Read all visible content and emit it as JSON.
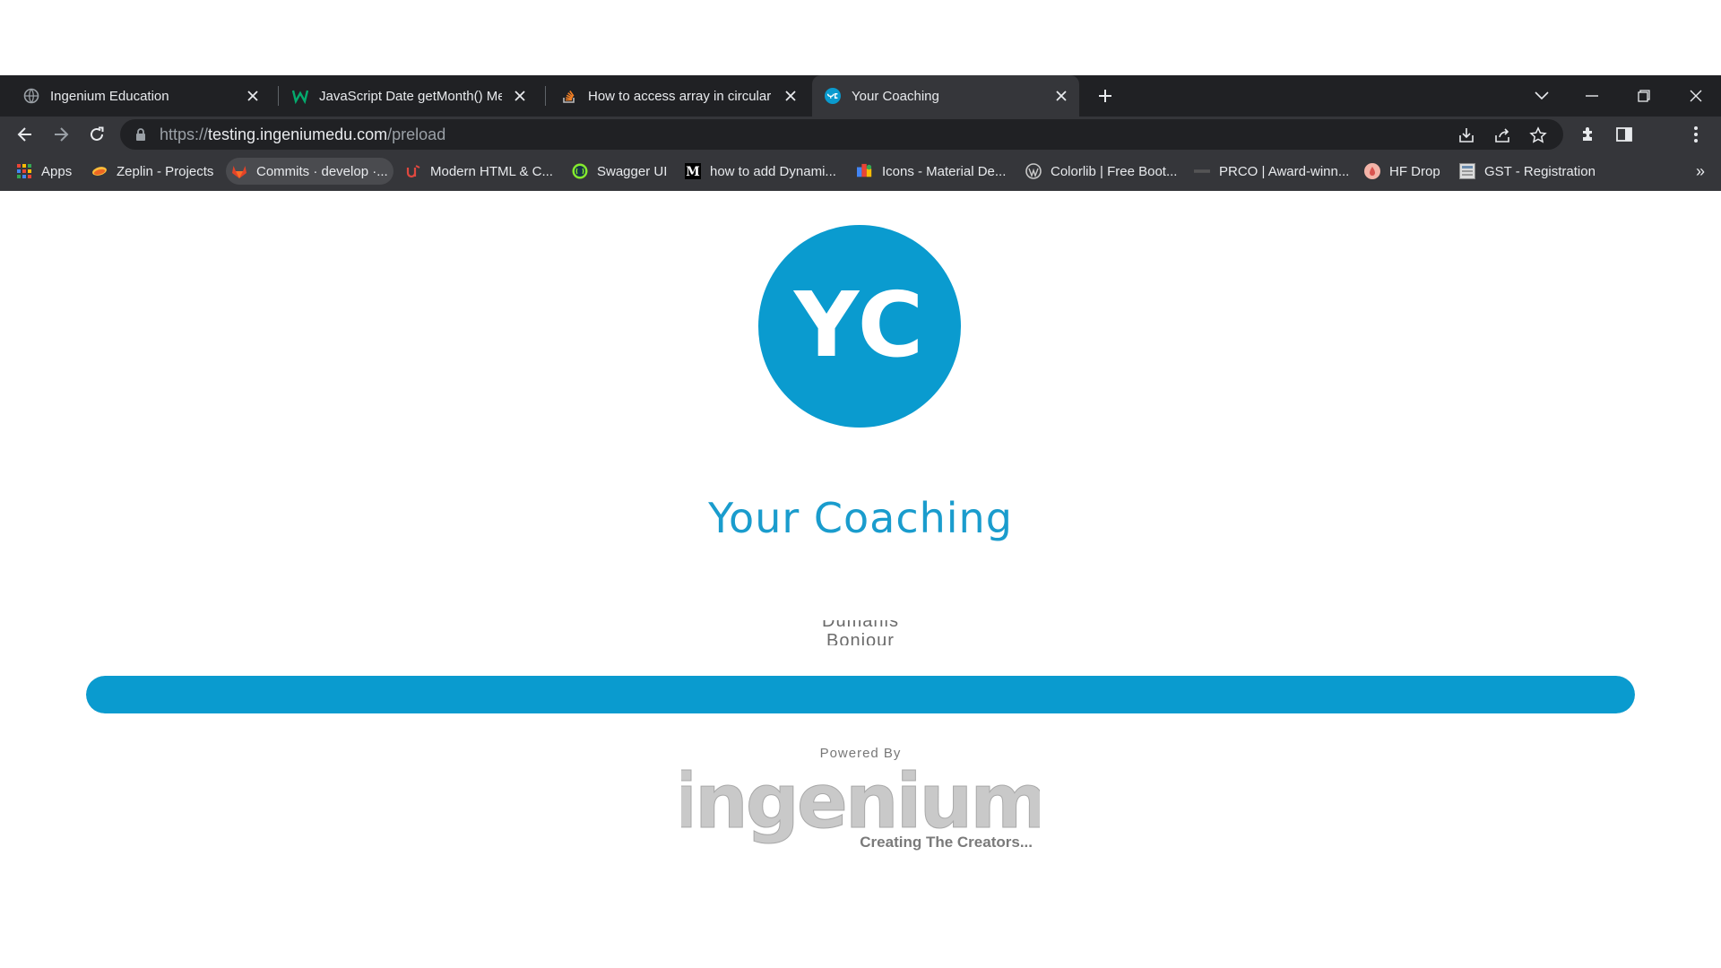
{
  "tabs": [
    {
      "title": "Ingenium Education",
      "icon": "globe-icon",
      "active": false
    },
    {
      "title": "JavaScript Date getMonth() Meth",
      "icon": "w3schools-icon",
      "active": false
    },
    {
      "title": "How to access array in circular m",
      "icon": "stackoverflow-icon",
      "active": false
    },
    {
      "title": "Your Coaching",
      "icon": "yc-icon",
      "active": true
    }
  ],
  "address_bar": {
    "scheme": "https://",
    "host": "testing.ingeniumedu.com",
    "path": "/preload"
  },
  "bookmarks": [
    {
      "label": "Apps",
      "icon": "apps-grid-icon"
    },
    {
      "label": "Zeplin - Projects",
      "icon": "zeplin-icon"
    },
    {
      "label": "Commits · develop ·...",
      "icon": "gitlab-icon"
    },
    {
      "label": "Modern HTML & C...",
      "icon": "udemy-icon"
    },
    {
      "label": "Swagger UI",
      "icon": "swagger-icon"
    },
    {
      "label": "how to add Dynami...",
      "icon": "medium-icon"
    },
    {
      "label": "Icons - Material De...",
      "icon": "material-icon"
    },
    {
      "label": "Colorlib | Free Boot...",
      "icon": "wordpress-icon"
    },
    {
      "label": "PRCO | Award-winn...",
      "icon": "prco-icon"
    },
    {
      "label": "HF Drop",
      "icon": "hf-drop-icon"
    },
    {
      "label": "GST - Registration",
      "icon": "gst-icon"
    }
  ],
  "bookmarks_overflow": "»",
  "page": {
    "logo_text": "YC",
    "title": "Your Coaching",
    "greetings": [
      "Dumanis",
      "Bonjour"
    ],
    "progress_percent": 100,
    "powered_by": "Powered By",
    "brand_word": "ingenium",
    "brand_tagline": "Creating The Creators..."
  },
  "colors": {
    "accent": "#0a9bcf",
    "title": "#1a9ccd",
    "chrome_dark": "#202124",
    "chrome_toolbar": "#35363a"
  }
}
